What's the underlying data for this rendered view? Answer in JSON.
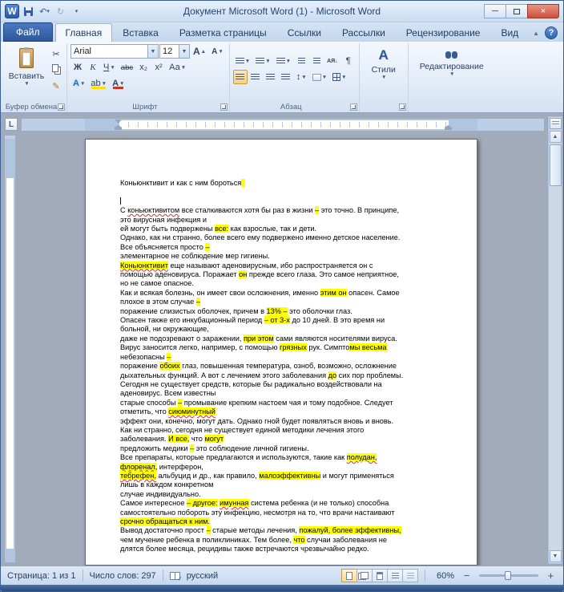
{
  "window": {
    "title": "Документ Microsoft Word (1)  -  Microsoft Word"
  },
  "icons": {
    "app": "W",
    "save": "disk",
    "undo": "↶",
    "redo": "↻",
    "cut": "✂",
    "format_painter": "✎",
    "find": "binoculars",
    "help": "?"
  },
  "ribbon": {
    "help": "?",
    "tabs": [
      {
        "label": "Файл",
        "file": true
      },
      {
        "label": "Главная",
        "active": true
      },
      {
        "label": "Вставка"
      },
      {
        "label": "Разметка страницы"
      },
      {
        "label": "Ссылки"
      },
      {
        "label": "Рассылки"
      },
      {
        "label": "Рецензирование"
      },
      {
        "label": "Вид"
      }
    ],
    "clipboard": {
      "paste": "Вставить",
      "label": "Буфер обмена"
    },
    "font": {
      "name": "Arial",
      "size": "12",
      "label": "Шрифт",
      "bold": "Ж",
      "italic": "К",
      "underline": "Ч",
      "strike": "abc",
      "subscript": "x₂",
      "superscript": "x²",
      "change_case": "Аа",
      "effects": "А",
      "highlight": "ab",
      "color": "А",
      "grow": "А",
      "shrink": "А"
    },
    "paragraph": {
      "label": "Абзац",
      "sort": "АЯ↓",
      "pilcrow": "¶"
    },
    "styles": {
      "label": "Стили",
      "icon": "А"
    },
    "editing": {
      "label": "Редактирование"
    }
  },
  "document": {
    "caret_line": 2,
    "lines": [
      [
        [
          "Коньюнктивит и как с ним бороться",
          ""
        ],
        [
          "  ",
          "h"
        ]
      ],
      [],
      [],
      [
        [
          "С ",
          ""
        ],
        [
          "коньюктивитом",
          "s"
        ],
        [
          " все сталкиваются хотя бы раз в жизни ",
          ""
        ],
        [
          "–",
          "h"
        ],
        [
          " это точно. В принципе,",
          ""
        ]
      ],
      [
        [
          "это вирусная инфекция и",
          ""
        ]
      ],
      [
        [
          "ей могут быть подвержены ",
          ""
        ],
        [
          "все:",
          "h"
        ],
        [
          " как взрослые, так и дети.",
          ""
        ]
      ],
      [
        [
          "Однако, как ни странно, более всего ему подвержено именно детское население.",
          ""
        ]
      ],
      [
        [
          "Все объясняется просто ",
          ""
        ],
        [
          "–",
          "h"
        ]
      ],
      [
        [
          "элементарное не соблюдение мер гигиены.",
          ""
        ]
      ],
      [
        [
          "Коньюнктивит",
          "hs"
        ],
        [
          " еще называют аденовирусным, ибо распространяется он с",
          ""
        ]
      ],
      [
        [
          "помощью аденовируса. Поражает ",
          ""
        ],
        [
          "он",
          "h"
        ],
        [
          " прежде всего глаза. Это самое неприятное,",
          ""
        ]
      ],
      [
        [
          "но не самое опасное.",
          ""
        ]
      ],
      [
        [
          "Как и всякая болезнь, он имеет свои осложнения, именно ",
          ""
        ],
        [
          "этим он",
          "h"
        ],
        [
          " опасен. Самое",
          ""
        ]
      ],
      [
        [
          "плохое в этом случае ",
          ""
        ],
        [
          "–",
          "h"
        ]
      ],
      [
        [
          "поражение слизистых оболочек, причем в ",
          ""
        ],
        [
          "13% –",
          "h"
        ],
        [
          " это оболочки глаз.",
          ""
        ]
      ],
      [
        [
          "Опасен также его инкубационный период ",
          ""
        ],
        [
          "– от 3-х",
          "h"
        ],
        [
          " до 10 дней. В это время ни",
          ""
        ]
      ],
      [
        [
          "больной, ни окружающие,",
          ""
        ]
      ],
      [
        [
          "даже не подозревают о заражении, ",
          ""
        ],
        [
          "при этом",
          "h"
        ],
        [
          " сами являются носителями вируса.",
          ""
        ]
      ],
      [
        [
          "Вирус заносится легко, например, с помощью ",
          ""
        ],
        [
          "грязных",
          "h"
        ],
        [
          " рук. Симпто",
          ""
        ],
        [
          "мы весьма",
          "h"
        ]
      ],
      [
        [
          "небезопасны ",
          ""
        ],
        [
          "–",
          "h"
        ]
      ],
      [
        [
          "поражение ",
          ""
        ],
        [
          "обоих",
          "h"
        ],
        [
          " глаз, повышенная температура, озноб, возможно, осложнение",
          ""
        ]
      ],
      [
        [
          "дыхательных функций. А вот с лечением этого заболевания ",
          ""
        ],
        [
          "до",
          "h"
        ],
        [
          " сих пор проблемы.",
          ""
        ]
      ],
      [
        [
          "Сегодня не существует средств, которые бы радикально воздействовали на",
          ""
        ]
      ],
      [
        [
          "аденовирус. Всем известны",
          ""
        ]
      ],
      [
        [
          "старые способы ",
          ""
        ],
        [
          "–",
          "h"
        ],
        [
          " промывание крепким настоем чая и тому подобное. Следует",
          ""
        ]
      ],
      [
        [
          "отметить, что ",
          ""
        ],
        [
          "сиюминутный",
          "hs"
        ]
      ],
      [
        [
          "эффект они, конечно, могут дать. Однако гной будет появляться вновь и вновь.",
          ""
        ]
      ],
      [
        [
          "Как ни странно, сегодня не существует единой методики лечения этого",
          ""
        ]
      ],
      [
        [
          "заболевания. ",
          ""
        ],
        [
          "И все,",
          "h"
        ],
        [
          " что ",
          ""
        ],
        [
          "могут",
          "h"
        ]
      ],
      [
        [
          "предложить медики ",
          ""
        ],
        [
          "–",
          "h"
        ],
        [
          " это соблюдение личной гигиены.",
          ""
        ]
      ],
      [
        [
          "Все препараты, которые предлагаются и используются, такие как ",
          ""
        ],
        [
          "полудан,",
          "hs"
        ]
      ],
      [
        [
          "флоренал,",
          "hs"
        ],
        [
          " интерферон,",
          ""
        ]
      ],
      [
        [
          "тебрефен,",
          "hs"
        ],
        [
          " альбуцид и др., как правило, ",
          ""
        ],
        [
          "малоэффективны",
          "h"
        ],
        [
          " и могут применяться",
          ""
        ]
      ],
      [
        [
          "лишь в каждом конкретном",
          ""
        ]
      ],
      [
        [
          "случае индивидуально.",
          ""
        ]
      ],
      [
        [
          "Самое интересное ",
          ""
        ],
        [
          "– другое:",
          "h"
        ],
        [
          " ",
          ""
        ],
        [
          "имунная",
          "hs"
        ],
        [
          " система ребенка (и не только) способна",
          ""
        ]
      ],
      [
        [
          "самостоятельно побороть эту инфекцию, несмотря на то, что врачи настаивают",
          ""
        ]
      ],
      [
        [
          "срочно обращаться к ним.",
          "h"
        ]
      ],
      [
        [
          "Вывод достаточно прост ",
          ""
        ],
        [
          "–",
          "h"
        ],
        [
          " старые методы лечения, ",
          ""
        ],
        [
          "пожалуй,",
          "h"
        ],
        [
          " более эффективны,",
          "h"
        ]
      ],
      [
        [
          "чем мучение ребенка в поликлиниках. Тем более, ",
          ""
        ],
        [
          "что",
          "h"
        ],
        [
          " случаи заболевания не",
          ""
        ]
      ],
      [
        [
          "длятся более месяца, рецидивы также встречаются чрезвычайно редко.",
          ""
        ]
      ]
    ]
  },
  "status": {
    "page": "Страница: 1 из 1",
    "words": "Число слов: 297",
    "language": "русский",
    "zoom": "60%"
  }
}
